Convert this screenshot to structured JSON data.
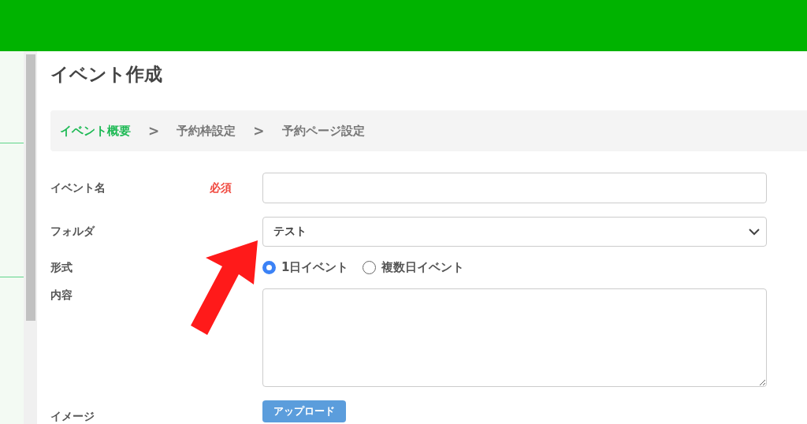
{
  "page": {
    "title": "イベント作成"
  },
  "steps": [
    {
      "label": "イベント概要",
      "selected": true
    },
    {
      "separator": ">",
      "label": "予約枠設定",
      "selected": false
    },
    {
      "separator": ">",
      "label": "予約ページ設定",
      "selected": false
    }
  ],
  "form": {
    "event_name": {
      "label": "イベント名",
      "required": "必須"
    },
    "folder": {
      "label": "フォルダ",
      "value": "テスト"
    },
    "format": {
      "label": "形式",
      "options": [
        {
          "label": "1日イベント",
          "selected": true
        },
        {
          "label": "複数日イベント",
          "selected": false
        }
      ]
    },
    "content": {
      "label": "内容"
    },
    "image": {
      "label": "イメージ",
      "button": "アップロード"
    }
  }
}
